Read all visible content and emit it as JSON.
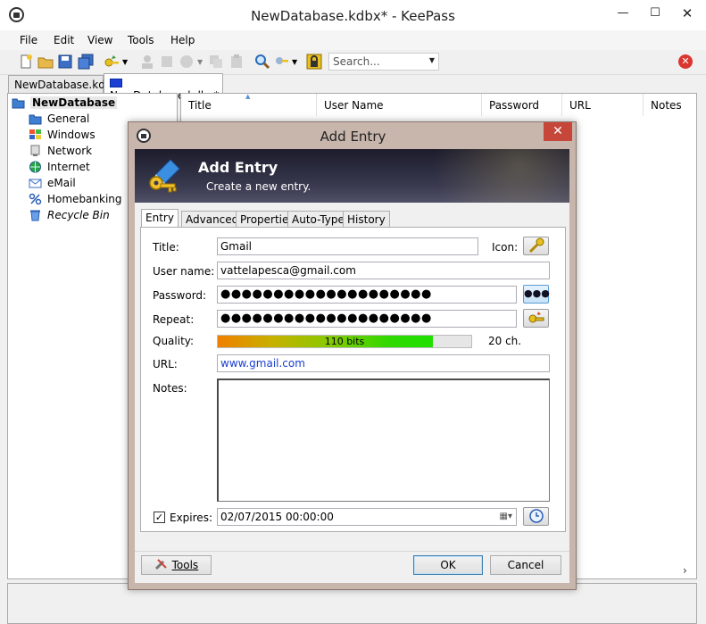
{
  "window": {
    "title": "NewDatabase.kdbx* - KeePass",
    "minimize_glyph": "—",
    "maximize_glyph": "☐",
    "close_glyph": "✕"
  },
  "menu": [
    "File",
    "Edit",
    "View",
    "Tools",
    "Help"
  ],
  "toolbar": {
    "search_placeholder": "Search...",
    "search_dropdown_glyph": "▼",
    "stop_glyph": "✕"
  },
  "doc_tabs": [
    "NewDatabase.kdbx",
    "NewDatabase.kdbx*"
  ],
  "groups": {
    "root": "NewDatabase",
    "items": [
      {
        "label": "General",
        "icon": "folder-icon"
      },
      {
        "label": "Windows",
        "icon": "windows-icon"
      },
      {
        "label": "Network",
        "icon": "network-icon"
      },
      {
        "label": "Internet",
        "icon": "globe-icon"
      },
      {
        "label": "eMail",
        "icon": "email-icon"
      },
      {
        "label": "Homebanking",
        "icon": "percent-icon"
      },
      {
        "label": "Recycle Bin",
        "icon": "recycle-bin-icon"
      }
    ]
  },
  "entry_list": {
    "columns": [
      "Title",
      "User Name",
      "Password",
      "URL",
      "Notes"
    ],
    "sort_glyph": "▲",
    "scroll_right_glyph": "›"
  },
  "dialog": {
    "title": "Add Entry",
    "close_glyph": "✕",
    "banner_title": "Add Entry",
    "banner_subtitle": "Create a new entry.",
    "tabs": [
      "Entry",
      "Advanced",
      "Properties",
      "Auto-Type",
      "History"
    ],
    "fields": {
      "title_label": "Title:",
      "title_value": "Gmail",
      "icon_label": "Icon:",
      "username_label": "User name:",
      "username_value": "vattelapesca@gmail.com",
      "password_label": "Password:",
      "password_value": "●●●●●●●●●●●●●●●●●●●●",
      "show_password_glyph": "●●●",
      "repeat_label": "Repeat:",
      "repeat_value": "●●●●●●●●●●●●●●●●●●●●",
      "quality_label": "Quality:",
      "quality_text": "110 bits",
      "quality_fraction": 0.85,
      "quality_chars": "20 ch.",
      "url_label": "URL:",
      "url_value": "www.gmail.com",
      "notes_label": "Notes:",
      "notes_value": "",
      "expires_label": "Expires:",
      "expires_checked_glyph": "✓",
      "expires_value": "02/07/2015 00:00:00",
      "expires_dropdown_glyph": "▦▾"
    },
    "buttons": {
      "tools": "Tools",
      "ok": "OK",
      "cancel": "Cancel"
    }
  }
}
